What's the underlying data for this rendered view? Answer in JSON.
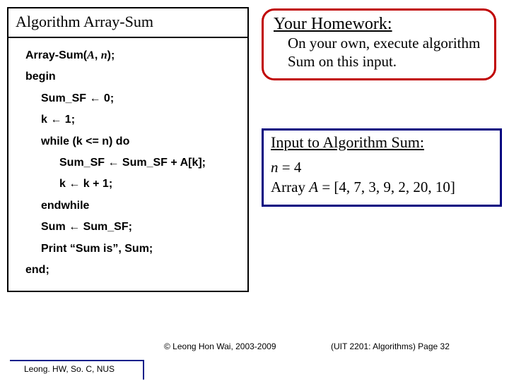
{
  "algo": {
    "title": "Algorithm Array-Sum",
    "sig_pre": "Array-Sum(",
    "sig_a": "A",
    "sig_comma": ", ",
    "sig_n": "n",
    "sig_post": ");",
    "begin": "begin",
    "l1_a": "Sum_SF ",
    "l1_arrow": "←",
    "l1_b": " 0;",
    "l2_a": "k ",
    "l2_arrow": "←",
    "l2_b": " 1;",
    "l3": "while (k <= n) do",
    "l4_a": "Sum_SF ",
    "l4_arrow": "←",
    "l4_b": " Sum_SF + A[k];",
    "l5_a": "k ",
    "l5_arrow": "←",
    "l5_b": " k + 1;",
    "l6": "endwhile",
    "l7_a": "Sum ",
    "l7_arrow": "←",
    "l7_b": " Sum_SF;",
    "l8": "Print “Sum is”, Sum;",
    "end": "end;"
  },
  "homework": {
    "title": "Your Homework:",
    "body": "On your own, execute algorithm Sum on this input."
  },
  "input": {
    "title": "Input to Algorithm Sum:",
    "n_lhs_i": "n",
    "n_rest": " = 4",
    "arr_pre": "Array ",
    "arr_i": "A",
    "arr_rest": " = [4, 7, 3, 9, 2, 20, 10]"
  },
  "footer": {
    "copyright": "© Leong Hon Wai, 2003-2009",
    "pagenote": "(UIT 2201: Algorithms) Page 32",
    "author": "Leong. HW, So. C, NUS"
  }
}
